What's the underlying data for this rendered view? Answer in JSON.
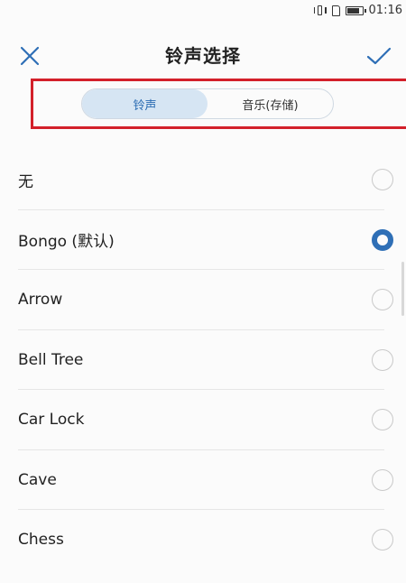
{
  "status_bar": {
    "time": "01:16",
    "icons": [
      "vibrate-icon",
      "sim-icon",
      "battery-icon"
    ]
  },
  "header": {
    "title": "铃声选择",
    "close_icon": "close-icon",
    "confirm_icon": "check-icon"
  },
  "tabs": [
    {
      "label": "铃声",
      "active": true
    },
    {
      "label": "音乐(存储)",
      "active": false
    }
  ],
  "ringtones": [
    {
      "label": "无",
      "selected": false
    },
    {
      "label": "Bongo (默认)",
      "selected": true
    },
    {
      "label": "Arrow",
      "selected": false
    },
    {
      "label": "Bell Tree",
      "selected": false
    },
    {
      "label": "Car Lock",
      "selected": false
    },
    {
      "label": "Cave",
      "selected": false
    },
    {
      "label": "Chess",
      "selected": false
    }
  ],
  "colors": {
    "accent": "#2f6fb6",
    "tab_active_bg": "#d6e5f3",
    "highlight": "#d3202a"
  }
}
